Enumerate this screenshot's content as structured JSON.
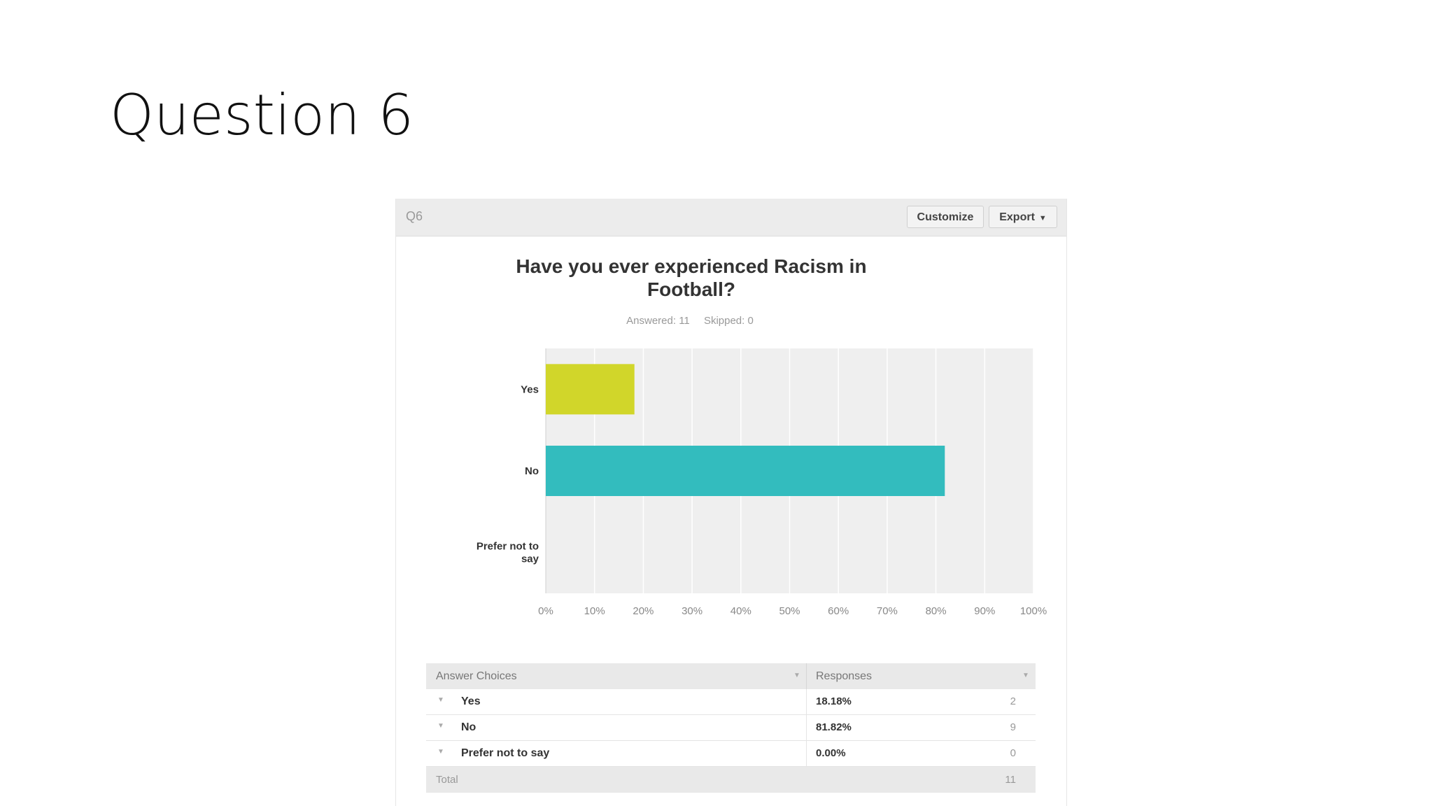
{
  "slide": {
    "title": "Question 6"
  },
  "header": {
    "question_number": "Q6",
    "customize_label": "Customize",
    "export_label": "Export"
  },
  "summary": {
    "answered": "Answered: 11",
    "skipped": "Skipped: 0"
  },
  "chart_data": {
    "type": "bar",
    "orientation": "horizontal",
    "title": "Have you ever experienced Racism in Football?",
    "categories": [
      "Yes",
      "No",
      "Prefer not to say"
    ],
    "values": [
      18.18,
      81.82,
      0.0
    ],
    "colors": [
      "#d1d62a",
      "#33bcbe",
      "#e0e0e0"
    ],
    "xlim": [
      0,
      100
    ],
    "x_ticks": [
      "0%",
      "10%",
      "20%",
      "30%",
      "40%",
      "50%",
      "60%",
      "70%",
      "80%",
      "90%",
      "100%"
    ],
    "grid": true
  },
  "table": {
    "col_choices": "Answer Choices",
    "col_responses": "Responses",
    "rows": [
      {
        "choice": "Yes",
        "percent": "18.18%",
        "count": "2"
      },
      {
        "choice": "No",
        "percent": "81.82%",
        "count": "9"
      },
      {
        "choice": "Prefer not to say",
        "percent": "0.00%",
        "count": "0"
      }
    ],
    "total_label": "Total",
    "total_value": "11"
  },
  "colors": {
    "plot_bg": "#efefef",
    "grid": "#ffffff",
    "header_bg": "#ececec"
  }
}
